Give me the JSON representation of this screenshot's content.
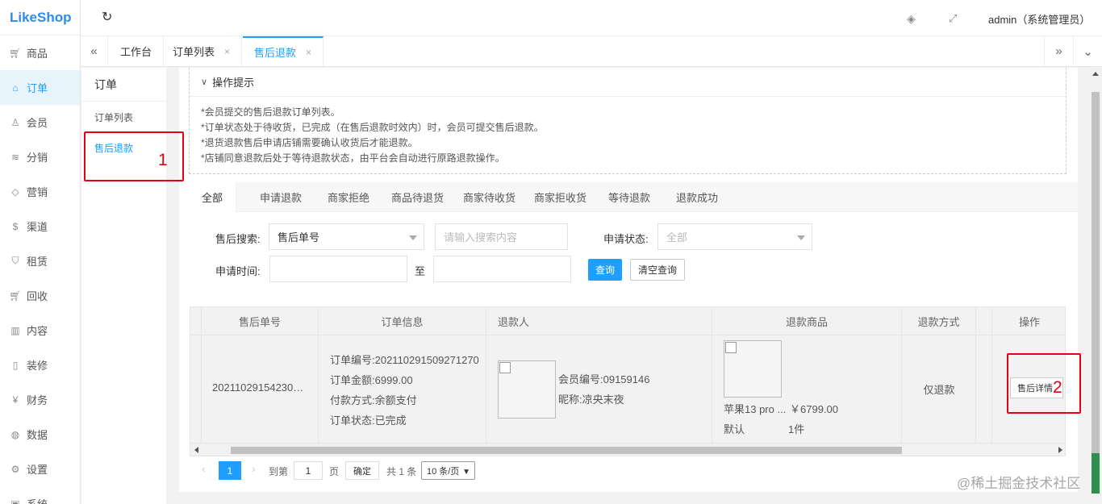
{
  "brand": {
    "logo_text": "LikeShop"
  },
  "sidebar": {
    "items": [
      {
        "label": "商品",
        "icon": "cart-icon"
      },
      {
        "label": "订单",
        "icon": "bell-icon",
        "active": true
      },
      {
        "label": "会员",
        "icon": "user-icon"
      },
      {
        "label": "分销",
        "icon": "layers-icon"
      },
      {
        "label": "营销",
        "icon": "diamond-icon"
      },
      {
        "label": "渠道",
        "icon": "dollar-icon"
      },
      {
        "label": "租赁",
        "icon": "shield-icon"
      },
      {
        "label": "回收",
        "icon": "cart-icon"
      },
      {
        "label": "内容",
        "icon": "book-icon"
      },
      {
        "label": "装修",
        "icon": "phone-icon"
      },
      {
        "label": "财务",
        "icon": "yen-icon"
      },
      {
        "label": "数据",
        "icon": "globe-icon"
      },
      {
        "label": "设置",
        "icon": "gear-icon"
      },
      {
        "label": "系统",
        "icon": "system-icon"
      }
    ]
  },
  "header": {
    "admin_label": "admin（系统管理员）"
  },
  "tabs": [
    {
      "label": "工作台"
    },
    {
      "label": "订单列表",
      "close": "×"
    },
    {
      "label": "售后退款",
      "close": "×",
      "active": true
    }
  ],
  "subnav": {
    "title": "订单",
    "items": [
      {
        "label": "订单列表"
      },
      {
        "label": "售后退款",
        "active": true
      }
    ]
  },
  "tips": {
    "title": "操作提示",
    "lines": [
      "*会员提交的售后退款订单列表。",
      "*订单状态处于待收货，已完成（在售后退款时效内）时，会员可提交售后退款。",
      "*退货退款售后申请店铺需要确认收货后才能退款。",
      "*店铺同意退款后处于等待退款状态，由平台会自动进行原路退款操作。"
    ]
  },
  "status_tabs": [
    "全部",
    "申请退款",
    "商家拒绝",
    "商品待退货",
    "商家待收货",
    "商家拒收货",
    "等待退款",
    "退款成功"
  ],
  "filters": {
    "search_label": "售后搜索:",
    "search_type": "售后单号",
    "search_placeholder": "请输入搜索内容",
    "status_label": "申请状态:",
    "status_value": "全部",
    "time_label": "申请时间:",
    "to_label": "至",
    "query_button": "查询",
    "clear_button": "清空查询"
  },
  "table": {
    "headers": [
      "售后单号",
      "订单信息",
      "退款人",
      "退款商品",
      "退款方式",
      "操作"
    ],
    "row": {
      "refund_no": "2021102915423021...",
      "order_no": "订单编号:202110291509271270",
      "order_amount": "订单金额:6999.00",
      "pay_method": "付款方式:余额支付",
      "order_status": "订单状态:已完成",
      "member_no": "会员编号:09159146",
      "nickname": "昵称:凉央末夜",
      "goods_name": "苹果13 pro ...",
      "goods_price": "￥6799.00",
      "goods_spec": "默认",
      "goods_qty": "1件",
      "refund_type": "仅退款",
      "action": "售后详情"
    }
  },
  "pagination": {
    "current": "1",
    "goto_label": "到第",
    "page_input": "1",
    "page_unit": "页",
    "confirm": "确定",
    "total": "共 1 条",
    "per_page": "10 条/页"
  },
  "annotations": {
    "one": "1",
    "two": "2"
  },
  "watermark": "@稀土掘金技术社区",
  "colors": {
    "accent": "#1e9fff",
    "annotation": "#e60012"
  }
}
